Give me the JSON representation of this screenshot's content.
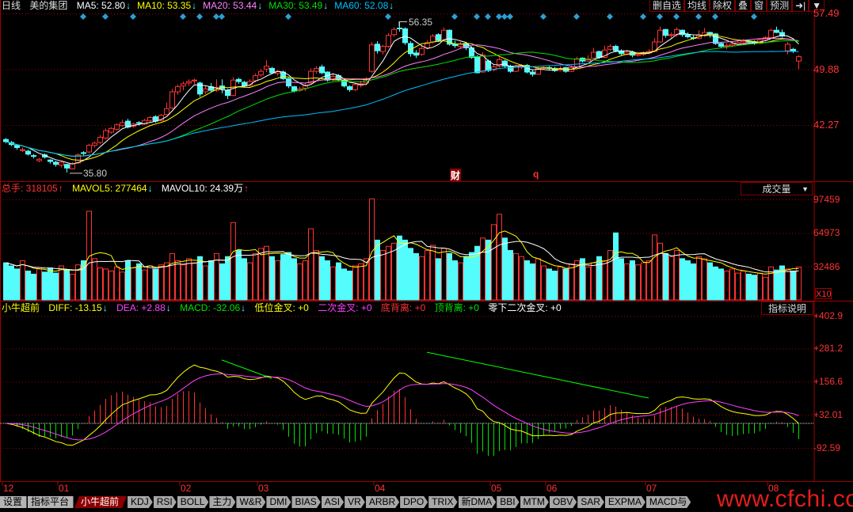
{
  "header": {
    "period": "日线",
    "stock_name": "美的集团",
    "ma": [
      {
        "label": "MA5: 52.80",
        "color": "#ffffff",
        "arrow": "arrow-down"
      },
      {
        "label": "MA10: 53.35",
        "color": "#ffff00",
        "arrow": "arrow-down"
      },
      {
        "label": "MA20: 53.44",
        "color": "#ff80ff",
        "arrow": "arrow-down"
      },
      {
        "label": "MA30: 53.49",
        "color": "#00e000",
        "arrow": "arrow-down"
      },
      {
        "label": "MA60: 52.08",
        "color": "#00c0ff",
        "arrow": "arrow-down"
      }
    ],
    "arrow_down_glyph": "↓",
    "arrow_up_glyph": "↑"
  },
  "toolbar": {
    "buttons": [
      "删自选",
      "均线",
      "除权",
      "叠",
      "窗",
      "预测",
      "➜|",
      "▼"
    ]
  },
  "volume_header": {
    "total": "总手: 318105",
    "mavol5": "MAVOL5: 277464",
    "mavol10": "MAVOL10: 24.39万",
    "dropdown_label": "成交量",
    "dropdown_caret": "▼",
    "scale_label": "X10"
  },
  "macd_header": {
    "name": "小牛超前",
    "diff": "DIFF: -13.15",
    "dea": "DEA: +2.88",
    "macd": "MACD: -32.06",
    "s1": "低位金叉: +0",
    "s2": "二次金叉: +0",
    "s3": "底背离: +0",
    "s4": "顶背离: +0",
    "s5": "零下二次金叉: +0",
    "explain_button": "指标说明"
  },
  "tabs": [
    "设置",
    "指标平台",
    "小牛超前",
    "KDJ",
    "RSI",
    "BOLL",
    "主力",
    "W&R",
    "DMI",
    "BIAS",
    "ASI",
    "VR",
    "ARBR",
    "DPO",
    "TRIX",
    "新DMA",
    "BBI",
    "MTM",
    "OBV",
    "SAR",
    "EXPMA",
    "MACD与"
  ],
  "active_tab": "小牛超前",
  "watermark": "www.cfchi.com",
  "colors": {
    "up": "#ff3232",
    "down": "#54fcfc",
    "grid": "#a00000",
    "frame": "#800000",
    "marker": "#2a9fd6",
    "diff": "#ffff00",
    "dea": "#ff40ff",
    "hist_up": "#ff3232",
    "hist_down": "#00e000",
    "divergence": "#00ff00",
    "mavol5": "#ffff00",
    "mavol10": "#ffffff"
  },
  "chart_data": [
    {
      "type": "candlestick",
      "name": "price",
      "y_ticks": [
        "57.49",
        "49.88",
        "42.27"
      ],
      "ylim": [
        35.3,
        58.5
      ],
      "grid": true,
      "ma_periods": [
        5,
        10,
        20,
        30,
        60
      ],
      "x_months": [
        {
          "label": "12",
          "index": 0
        },
        {
          "label": "01",
          "index": 10
        },
        {
          "label": "02",
          "index": 32
        },
        {
          "label": "03",
          "index": 46
        },
        {
          "label": "04",
          "index": 67
        },
        {
          "label": "05",
          "index": 88
        },
        {
          "label": "06",
          "index": 98
        },
        {
          "label": "07",
          "index": 116
        },
        {
          "label": "08",
          "index": 138
        }
      ],
      "annotations": [
        {
          "text": "56.35",
          "index": 71,
          "price": 56.35,
          "kind": "high"
        },
        {
          "text": "35.80",
          "index": 11,
          "price": 35.8,
          "kind": "low"
        },
        {
          "text": "财",
          "index": 81,
          "kind": "event"
        },
        {
          "text": "q",
          "index": 96,
          "kind": "event"
        }
      ],
      "marker_indices": [
        14,
        18,
        23,
        32,
        35,
        38,
        39,
        51,
        69,
        81,
        85,
        87,
        89,
        90,
        91,
        97,
        103,
        109,
        115,
        118,
        121,
        125,
        128,
        135
      ],
      "ohlc": [
        [
          40.3,
          40.5,
          39.8,
          40.0
        ],
        [
          39.9,
          40.1,
          39.4,
          39.6
        ],
        [
          39.5,
          39.6,
          38.9,
          39.2
        ],
        [
          38.8,
          39.2,
          38.6,
          38.9
        ],
        [
          38.7,
          38.9,
          38.1,
          38.3
        ],
        [
          38.1,
          38.3,
          37.7,
          38.0
        ],
        [
          37.4,
          37.8,
          37.2,
          37.6
        ],
        [
          38.2,
          38.4,
          37.7,
          37.9
        ],
        [
          37.5,
          37.6,
          37.0,
          37.3
        ],
        [
          37.2,
          37.4,
          36.6,
          36.9
        ],
        [
          36.8,
          37.4,
          36.5,
          37.2
        ],
        [
          36.9,
          37.0,
          35.8,
          36.4
        ],
        [
          36.3,
          37.2,
          36.2,
          37.0
        ],
        [
          37.1,
          38.4,
          37.0,
          38.2
        ],
        [
          38.5,
          38.7,
          38.0,
          38.4
        ],
        [
          38.6,
          39.7,
          38.4,
          39.5
        ],
        [
          39.5,
          40.0,
          39.2,
          39.8
        ],
        [
          39.9,
          40.9,
          39.7,
          40.6
        ],
        [
          40.5,
          41.8,
          40.3,
          41.5
        ],
        [
          41.3,
          42.0,
          41.1,
          41.8
        ],
        [
          41.7,
          42.5,
          41.5,
          42.3
        ],
        [
          42.2,
          43.0,
          42.0,
          42.6
        ],
        [
          42.8,
          43.1,
          41.8,
          42.0
        ],
        [
          42.1,
          42.6,
          41.9,
          42.4
        ],
        [
          42.6,
          42.8,
          42.2,
          42.5
        ],
        [
          42.4,
          43.1,
          42.3,
          42.9
        ],
        [
          42.9,
          43.5,
          42.6,
          43.3
        ],
        [
          43.4,
          43.6,
          42.6,
          42.8
        ],
        [
          42.9,
          43.8,
          42.8,
          43.6
        ],
        [
          43.7,
          45.3,
          43.6,
          44.5
        ],
        [
          44.6,
          47.2,
          44.4,
          46.8
        ],
        [
          46.8,
          47.8,
          46.4,
          47.5
        ],
        [
          47.6,
          48.2,
          47.0,
          47.9
        ],
        [
          48.0,
          48.5,
          47.6,
          48.2
        ],
        [
          48.3,
          48.6,
          47.9,
          48.4
        ],
        [
          48.0,
          48.2,
          46.1,
          46.5
        ],
        [
          46.8,
          47.6,
          46.5,
          47.2
        ],
        [
          47.5,
          48.0,
          46.8,
          47.0
        ],
        [
          47.0,
          48.5,
          46.8,
          47.4
        ],
        [
          47.6,
          48.5,
          46.6,
          47.2
        ],
        [
          47.0,
          47.2,
          45.8,
          46.3
        ],
        [
          46.3,
          48.8,
          46.2,
          48.4
        ],
        [
          48.5,
          48.7,
          47.9,
          48.2
        ],
        [
          48.1,
          48.3,
          47.4,
          47.6
        ],
        [
          47.7,
          48.5,
          47.5,
          48.2
        ],
        [
          48.3,
          49.3,
          48.1,
          49.0
        ],
        [
          49.1,
          49.9,
          48.9,
          49.6
        ],
        [
          49.9,
          51.1,
          49.5,
          50.3
        ],
        [
          50.0,
          50.2,
          49.2,
          49.4
        ],
        [
          49.3,
          49.8,
          49.0,
          49.6
        ],
        [
          49.5,
          49.7,
          48.4,
          48.6
        ],
        [
          48.6,
          48.7,
          47.3,
          47.6
        ],
        [
          47.5,
          47.6,
          46.7,
          46.9
        ],
        [
          47.0,
          47.5,
          46.8,
          47.2
        ],
        [
          47.3,
          48.0,
          46.9,
          47.7
        ],
        [
          48.0,
          50.0,
          47.9,
          49.6
        ],
        [
          49.6,
          50.3,
          49.3,
          50.0
        ],
        [
          50.2,
          50.5,
          49.2,
          49.4
        ],
        [
          49.5,
          49.6,
          48.2,
          48.4
        ],
        [
          48.5,
          49.3,
          48.3,
          48.9
        ],
        [
          49.0,
          49.2,
          48.3,
          48.5
        ],
        [
          48.4,
          48.6,
          47.4,
          47.6
        ],
        [
          47.5,
          47.7,
          46.8,
          47.1
        ],
        [
          47.1,
          48.0,
          46.9,
          47.8
        ],
        [
          47.7,
          48.3,
          47.4,
          47.9
        ],
        [
          48.0,
          48.8,
          47.8,
          48.6
        ],
        [
          49.6,
          53.6,
          49.4,
          53.2
        ],
        [
          53.3,
          53.7,
          52.0,
          52.4
        ],
        [
          52.3,
          53.2,
          51.9,
          53.0
        ],
        [
          53.0,
          54.8,
          52.8,
          54.5
        ],
        [
          54.6,
          55.6,
          54.3,
          55.3
        ],
        [
          55.5,
          56.35,
          55.0,
          55.4
        ],
        [
          55.4,
          55.6,
          53.2,
          53.5
        ],
        [
          53.4,
          53.7,
          51.6,
          52.0
        ],
        [
          52.1,
          52.5,
          51.4,
          51.8
        ],
        [
          51.9,
          53.2,
          51.7,
          52.7
        ],
        [
          52.8,
          53.8,
          52.6,
          53.5
        ],
        [
          53.6,
          54.7,
          53.4,
          54.4
        ],
        [
          54.6,
          54.8,
          53.6,
          53.8
        ],
        [
          53.9,
          55.6,
          53.7,
          55.2
        ],
        [
          55.2,
          55.3,
          53.1,
          53.3
        ],
        [
          53.3,
          53.8,
          52.8,
          53.1
        ],
        [
          53.0,
          53.6,
          52.8,
          53.3
        ],
        [
          53.4,
          53.6,
          52.5,
          52.8
        ],
        [
          52.8,
          53.0,
          51.3,
          51.5
        ],
        [
          51.6,
          51.8,
          49.3,
          49.4
        ],
        [
          49.5,
          52.2,
          49.4,
          51.8
        ],
        [
          51.0,
          51.2,
          49.5,
          49.7
        ],
        [
          49.8,
          50.5,
          49.6,
          50.2
        ],
        [
          50.3,
          51.5,
          50.1,
          51.2
        ],
        [
          51.0,
          51.2,
          50.1,
          50.3
        ],
        [
          50.3,
          50.5,
          49.4,
          49.6
        ],
        [
          49.6,
          50.5,
          49.5,
          50.3
        ],
        [
          50.2,
          50.6,
          49.9,
          50.4
        ],
        [
          50.4,
          50.6,
          49.3,
          49.5
        ],
        [
          49.5,
          49.8,
          48.9,
          49.2
        ],
        [
          49.2,
          50.2,
          49.1,
          50.0
        ],
        [
          50.0,
          50.4,
          49.8,
          50.1
        ],
        [
          50.1,
          50.3,
          49.7,
          50.0
        ],
        [
          50.0,
          50.2,
          49.5,
          49.7
        ],
        [
          49.7,
          50.3,
          49.6,
          50.0
        ],
        [
          50.1,
          50.2,
          49.4,
          49.6
        ],
        [
          49.6,
          50.4,
          49.5,
          50.1
        ],
        [
          50.2,
          51.6,
          50.1,
          51.3
        ],
        [
          51.4,
          51.5,
          50.8,
          51.0
        ],
        [
          51.0,
          51.8,
          50.9,
          51.3
        ],
        [
          51.4,
          52.8,
          51.3,
          52.2
        ],
        [
          52.3,
          52.4,
          51.3,
          51.5
        ],
        [
          51.5,
          53.1,
          51.4,
          52.5
        ],
        [
          52.6,
          53.3,
          52.4,
          53.0
        ],
        [
          53.0,
          53.2,
          52.2,
          52.4
        ],
        [
          52.4,
          52.6,
          51.8,
          52.0
        ],
        [
          51.9,
          52.5,
          51.8,
          52.2
        ],
        [
          52.2,
          52.4,
          51.5,
          51.8
        ],
        [
          51.8,
          52.2,
          51.6,
          51.9
        ],
        [
          51.9,
          52.3,
          51.7,
          52.1
        ],
        [
          52.1,
          52.6,
          51.9,
          52.3
        ],
        [
          52.3,
          54.1,
          52.2,
          53.6
        ],
        [
          53.6,
          55.7,
          53.5,
          55.2
        ],
        [
          55.3,
          55.4,
          54.2,
          54.5
        ],
        [
          54.5,
          54.9,
          54.1,
          54.6
        ],
        [
          54.6,
          55.6,
          54.3,
          55.3
        ],
        [
          55.2,
          55.3,
          54.3,
          54.6
        ],
        [
          54.6,
          54.9,
          54.1,
          54.3
        ],
        [
          54.2,
          54.5,
          53.9,
          54.1
        ],
        [
          54.1,
          55.2,
          54.0,
          54.5
        ],
        [
          54.5,
          55.5,
          54.3,
          54.9
        ],
        [
          54.9,
          55.0,
          54.2,
          54.7
        ],
        [
          54.7,
          54.8,
          53.2,
          53.4
        ],
        [
          53.4,
          53.6,
          52.8,
          53.0
        ],
        [
          53.0,
          53.4,
          52.6,
          53.1
        ],
        [
          53.1,
          53.6,
          52.9,
          53.3
        ],
        [
          53.3,
          53.8,
          53.1,
          53.5
        ],
        [
          53.5,
          54.0,
          53.3,
          53.7
        ],
        [
          53.7,
          53.9,
          53.4,
          53.6
        ],
        [
          53.6,
          53.8,
          53.2,
          53.4
        ],
        [
          53.4,
          54.1,
          53.3,
          53.9
        ],
        [
          53.9,
          54.4,
          53.7,
          54.2
        ],
        [
          54.2,
          55.4,
          54.1,
          55.2
        ],
        [
          55.2,
          55.7,
          54.8,
          54.9
        ],
        [
          54.9,
          55.3,
          54.2,
          54.4
        ],
        [
          52.4,
          53.6,
          51.9,
          53.3
        ],
        [
          52.6,
          52.8,
          52.1,
          52.4
        ],
        [
          51.0,
          51.8,
          49.9,
          51.6
        ]
      ]
    },
    {
      "type": "bar",
      "name": "volume",
      "y_ticks": [
        "97459",
        "64973",
        "32486"
      ],
      "ylim": [
        0,
        97459
      ],
      "unit_multiplier": 10,
      "mavol_periods": [
        5,
        10
      ],
      "values": [
        36000,
        33000,
        30000,
        38000,
        28000,
        25000,
        30000,
        27000,
        31000,
        26000,
        33000,
        29000,
        25000,
        34000,
        38000,
        86000,
        40000,
        31000,
        30000,
        28000,
        32000,
        27000,
        38000,
        31000,
        35000,
        29000,
        33000,
        30000,
        34000,
        36000,
        45000,
        38000,
        34000,
        40000,
        36000,
        42000,
        33000,
        38000,
        45000,
        35000,
        42000,
        75000,
        48000,
        40000,
        36000,
        45000,
        50000,
        52000,
        42000,
        38000,
        44000,
        46000,
        40000,
        35000,
        38000,
        69000,
        48000,
        42000,
        38000,
        32000,
        36000,
        30000,
        28000,
        33000,
        35000,
        40000,
        98000,
        58000,
        48000,
        52000,
        55000,
        62000,
        58000,
        50000,
        45000,
        42000,
        48000,
        53000,
        40000,
        50000,
        45000,
        38000,
        36000,
        42000,
        46000,
        52000,
        60000,
        58000,
        73000,
        83000,
        60000,
        48000,
        45000,
        42000,
        38000,
        35000,
        40000,
        33000,
        30000,
        28000,
        32000,
        30000,
        35000,
        38000,
        40000,
        32000,
        36000,
        42000,
        38000,
        48000,
        65000,
        40000,
        35000,
        38000,
        34000,
        36000,
        38000,
        63000,
        55000,
        45000,
        42000,
        48000,
        40000,
        38000,
        35000,
        42000,
        40000,
        36000,
        32000,
        30000,
        28000,
        30000,
        26000,
        28000,
        25000,
        24000,
        26000,
        22000,
        32000,
        29000,
        33000,
        30000,
        28000,
        31810
      ]
    },
    {
      "type": "macd",
      "name": "小牛超前",
      "y_ticks": [
        "+402.9",
        "+281.2",
        "+156.6",
        "+32.01",
        "-92.59"
      ],
      "ylim": [
        -130,
        430
      ],
      "params": {
        "fast": 12,
        "slow": 26,
        "signal": 9,
        "scale": 100
      },
      "divergence_lines": [
        {
          "from_index": 39,
          "from_value": 238,
          "to_index": 48,
          "to_value": 169
        },
        {
          "from_index": 76,
          "from_value": 267,
          "to_index": 116,
          "to_value": 95
        }
      ]
    }
  ]
}
